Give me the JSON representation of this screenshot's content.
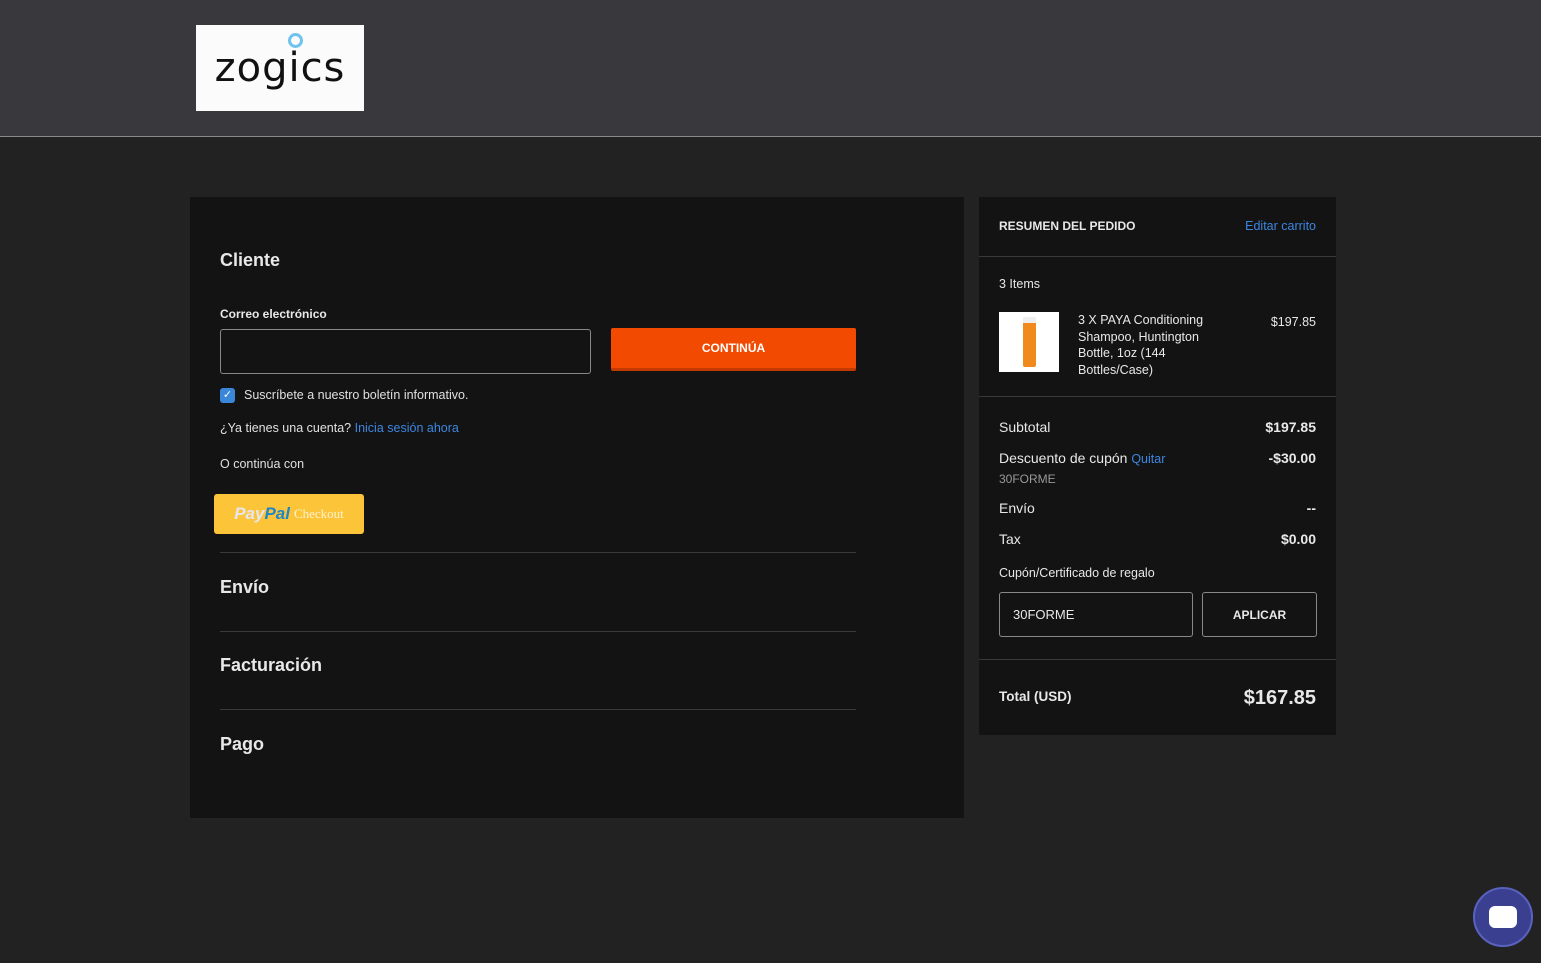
{
  "header": {
    "logo_text": "zogics"
  },
  "customer": {
    "title": "Cliente",
    "email_label": "Correo electrónico",
    "email_value": "",
    "continue_label": "CONTINÚA",
    "newsletter_label": "Suscríbete a nuestro boletín informativo.",
    "newsletter_checked": true,
    "account_prompt": "¿Ya tienes una cuenta?",
    "signin_link": "Inicia sesión ahora",
    "or_continue": "O continúa con",
    "paypal_pay": "Pay",
    "paypal_pal": "Pal",
    "paypal_checkout": "Checkout"
  },
  "sections": {
    "shipping": "Envío",
    "billing": "Facturación",
    "payment": "Pago"
  },
  "summary": {
    "title": "RESUMEN DEL PEDIDO",
    "edit_cart": "Editar carrito",
    "items_count": "3 Items",
    "item": {
      "name": "3 X PAYA Conditioning Shampoo, Huntington Bottle, 1oz (144 Bottles/Case)",
      "price": "$197.85"
    },
    "subtotal_label": "Subtotal",
    "subtotal": "$197.85",
    "discount_label": "Descuento de cupón",
    "remove_label": "Quitar",
    "discount": "-$30.00",
    "coupon_code": "30FORME",
    "shipping_label": "Envío",
    "shipping": "--",
    "tax_label": "Tax",
    "tax": "$0.00",
    "coupon_field_label": "Cupón/Certificado de regalo",
    "coupon_value": "30FORME",
    "apply_label": "APLICAR",
    "total_label": "Total (USD)",
    "total": "$167.85"
  }
}
